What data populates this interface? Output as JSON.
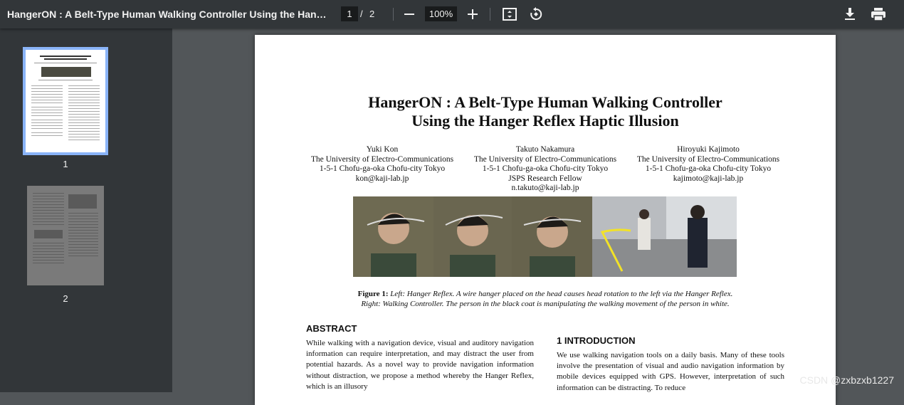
{
  "toolbar": {
    "title": "HangerON : A Belt-Type Human Walking Controller Using the Hanger R...",
    "current_page": "1",
    "separator": "/",
    "total_pages": "2",
    "zoom": "100%",
    "icons": [
      "minus-icon",
      "plus-icon",
      "fit-page-icon",
      "rotate-icon",
      "download-icon",
      "print-icon"
    ]
  },
  "sidebar": {
    "thumbnails": [
      {
        "label": "1",
        "selected": true
      },
      {
        "label": "2",
        "selected": false
      }
    ]
  },
  "paper": {
    "title_line1": "HangerON : A Belt-Type Human Walking Controller",
    "title_line2": "Using the Hanger Reflex Haptic Illusion",
    "authors": [
      {
        "name": "Yuki Kon",
        "affiliation": "The University of Electro-Communications",
        "address": "1-5-1 Chofu-ga-oka Chofu-city Tokyo",
        "extra": "",
        "email": "kon@kaji-lab.jp"
      },
      {
        "name": "Takuto Nakamura",
        "affiliation": "The University of Electro-Communications",
        "address": "1-5-1 Chofu-ga-oka Chofu-city Tokyo",
        "extra": "JSPS Research Fellow",
        "email": "n.takuto@kaji-lab.jp"
      },
      {
        "name": "Hiroyuki Kajimoto",
        "affiliation": "The University of Electro-Communications",
        "address": "1-5-1 Chofu-ga-oka Chofu-city Tokyo",
        "extra": "",
        "email": "kajimoto@kaji-lab.jp"
      }
    ],
    "caption_label": "Figure 1:",
    "caption_line1": "Left: Hanger Reflex. A wire hanger placed on the head causes head rotation to the left via the Hanger Reflex.",
    "caption_line2": "Right: Walking Controller. The person in the black coat is manipulating the walking movement of the person in white.",
    "abstract_heading": "ABSTRACT",
    "abstract_text": "While walking with a navigation device, visual and auditory navigation information can require interpretation, and may distract the user from potential hazards. As a novel way to provide navigation information without distraction, we propose a method whereby the Hanger Reflex, which is an illusory",
    "intro_heading": "1 INTRODUCTION",
    "intro_text": "We use walking navigation tools on a daily basis. Many of these tools involve the presentation of visual and audio navigation information by mobile devices equipped with GPS. However, interpretation of such information can be distracting. To reduce"
  },
  "watermark": "CSDN @zxbzxb1227"
}
